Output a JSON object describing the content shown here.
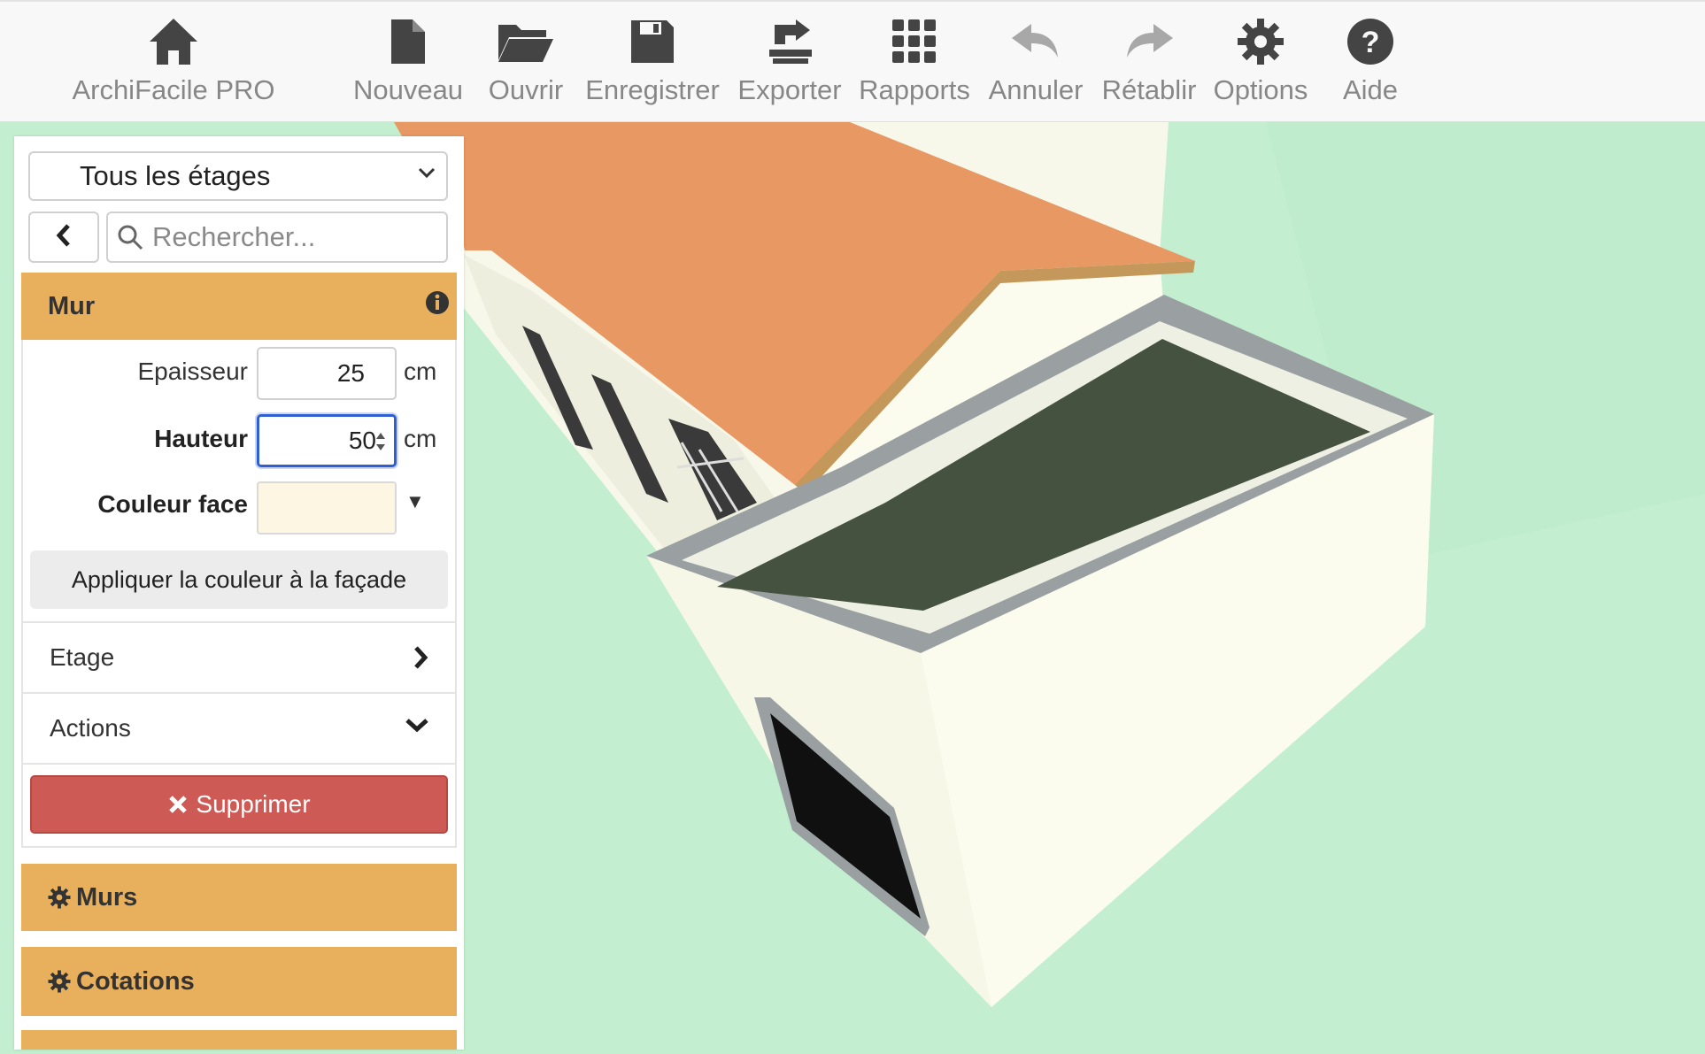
{
  "toolbar": {
    "app": {
      "label": "ArchiFacile PRO",
      "icon": "home-icon"
    },
    "items": [
      {
        "label": "Nouveau",
        "icon": "file-icon"
      },
      {
        "label": "Ouvrir",
        "icon": "folder-open-icon"
      },
      {
        "label": "Enregistrer",
        "icon": "save-icon"
      },
      {
        "label": "Exporter",
        "icon": "export-icon"
      },
      {
        "label": "Rapports",
        "icon": "grid-icon"
      },
      {
        "label": "Annuler",
        "icon": "undo-icon"
      },
      {
        "label": "Rétablir",
        "icon": "redo-icon"
      },
      {
        "label": "Options",
        "icon": "gear-icon"
      },
      {
        "label": "Aide",
        "icon": "help-icon"
      }
    ]
  },
  "sidebar": {
    "floor_select": {
      "value": "Tous les étages"
    },
    "search": {
      "placeholder": "Rechercher..."
    },
    "mur": {
      "title": "Mur",
      "epaisseur": {
        "label": "Epaisseur",
        "value": "25",
        "unit": "cm"
      },
      "hauteur": {
        "label": "Hauteur",
        "value": "50",
        "unit": "cm"
      },
      "couleur_face": {
        "label": "Couleur face",
        "value": "#fdf6e3",
        "dropdown": "▼"
      },
      "apply_label": "Appliquer la couleur à la façade",
      "etage_label": "Etage",
      "actions_label": "Actions",
      "delete_label": "Supprimer"
    },
    "sections": [
      {
        "label": "Murs"
      },
      {
        "label": "Cotations"
      }
    ]
  },
  "colors": {
    "accent": "#e8b05c",
    "danger": "#cd5a55",
    "ground": "#c3efd0",
    "roof": "#e89863",
    "wall": "#fbfbee",
    "flat_roof": "#465240"
  }
}
